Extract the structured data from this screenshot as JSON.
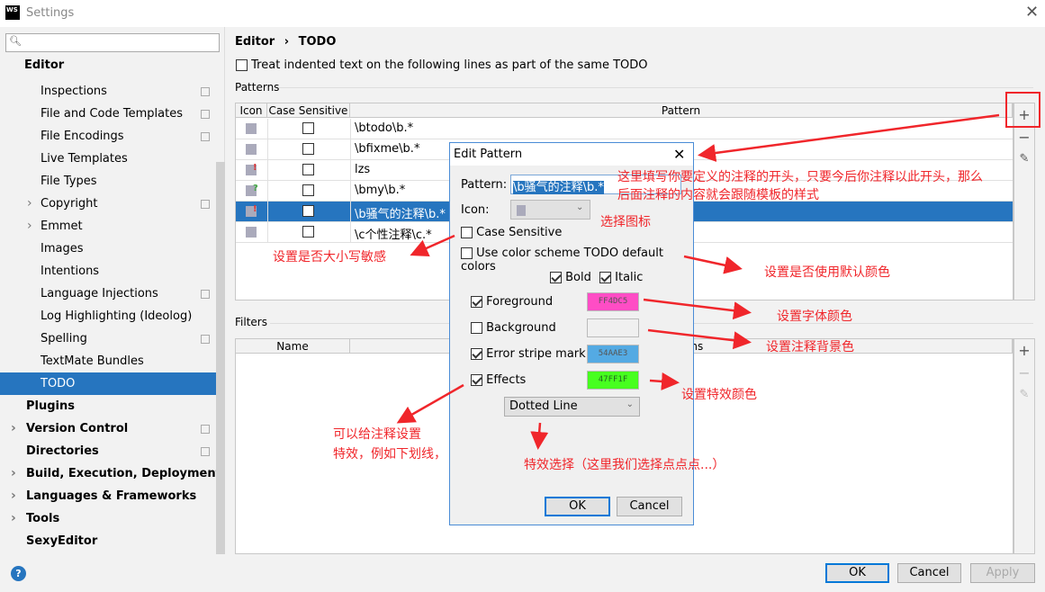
{
  "window": {
    "title": "Settings",
    "logo": "WS"
  },
  "sidebar": {
    "search_placeholder": "",
    "items": [
      {
        "label": "Editor",
        "bold": true
      },
      {
        "label": "Inspections",
        "copy": true
      },
      {
        "label": "File and Code Templates",
        "copy": true
      },
      {
        "label": "File Encodings",
        "copy": true
      },
      {
        "label": "Live Templates"
      },
      {
        "label": "File Types"
      },
      {
        "label": "Copyright",
        "arrow": true,
        "copy": true
      },
      {
        "label": "Emmet",
        "arrow": true
      },
      {
        "label": "Images"
      },
      {
        "label": "Intentions"
      },
      {
        "label": "Language Injections",
        "copy": true
      },
      {
        "label": "Log Highlighting (Ideolog)"
      },
      {
        "label": "Spelling",
        "copy": true
      },
      {
        "label": "TextMate Bundles"
      },
      {
        "label": "TODO",
        "selected": true
      },
      {
        "label": "Plugins",
        "bold": true
      },
      {
        "label": "Version Control",
        "bold": true,
        "arrow": true,
        "copy": true
      },
      {
        "label": "Directories",
        "bold": true,
        "copy": true
      },
      {
        "label": "Build, Execution, Deployment",
        "bold": true,
        "arrow": true
      },
      {
        "label": "Languages & Frameworks",
        "bold": true,
        "arrow": true
      },
      {
        "label": "Tools",
        "bold": true,
        "arrow": true
      },
      {
        "label": "SexyEditor",
        "bold": true
      }
    ]
  },
  "breadcrumb": {
    "parent": "Editor",
    "sep": "›",
    "current": "TODO"
  },
  "indent_option": "Treat indented text on the following lines as part of the same TODO",
  "patterns": {
    "label": "Patterns",
    "headers": [
      "Icon",
      "Case Sensitive",
      "Pattern"
    ],
    "rows": [
      {
        "icon": "todo-icon",
        "pattern": "\\btodo\\b.*"
      },
      {
        "icon": "todo-icon",
        "pattern": "\\bfixme\\b.*"
      },
      {
        "icon": "important-icon",
        "pattern": "lzs"
      },
      {
        "icon": "question-icon",
        "pattern": "\\bmy\\b.*"
      },
      {
        "icon": "important-icon",
        "pattern": "\\b骚气的注释\\b.*",
        "selected": true
      },
      {
        "icon": "todo-icon",
        "pattern": "\\c个性注释\\c.*"
      }
    ]
  },
  "filters": {
    "label": "Filters",
    "headers": [
      "Name",
      "Patterns"
    ]
  },
  "buttons": {
    "ok": "OK",
    "cancel": "Cancel",
    "apply": "Apply",
    "help": "?"
  },
  "dialog": {
    "title": "Edit Pattern",
    "pattern_label": "Pattern:",
    "pattern_value": "\\b骚气的注释\\b.*",
    "icon_label": "Icon:",
    "case_sensitive": "Case Sensitive",
    "use_default": "Use color scheme TODO default colors",
    "bold": "Bold",
    "italic": "Italic",
    "foreground": {
      "label": "Foreground",
      "checked": true,
      "color": "#FF4DC5",
      "text": "FF4DC5"
    },
    "background": {
      "label": "Background",
      "checked": false,
      "color": "#F0F0F0",
      "text": ""
    },
    "error_stripe": {
      "label": "Error stripe mark",
      "checked": true,
      "color": "#54AAE3",
      "text": "54AAE3"
    },
    "effects": {
      "label": "Effects",
      "checked": true,
      "color": "#47FF1F",
      "text": "47FF1F"
    },
    "effect_type": "Dotted Line",
    "ok": "OK",
    "cancel": "Cancel"
  },
  "annotations": {
    "pattern": "这里填写你要定义的注释的开头，只要今后你注释以此开头，那么",
    "pattern2": "后面注释的内容就会跟随模板的样式",
    "icon": "选择图标",
    "case": "设置是否大小写敏感",
    "default": "设置是否使用默认颜色",
    "fg": "设置字体颜色",
    "bg": "设置注释背景色",
    "effects_color": "设置特效颜色",
    "effects1": "可以给注释设置",
    "effects2": "特效，例如下划线，",
    "effect_type": "特效选择（这里我们选择点点点...）"
  }
}
